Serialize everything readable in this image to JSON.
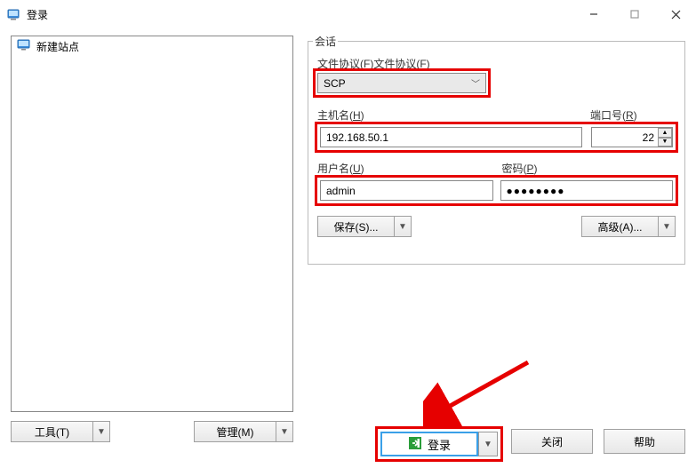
{
  "window": {
    "title": "登录"
  },
  "sidebar": {
    "new_site": "新建站点"
  },
  "session": {
    "group_label": "会话",
    "protocol_label": "文件协议(F)",
    "protocol_value": "SCP",
    "host_label": "主机名(H)",
    "host_value": "192.168.50.1",
    "port_label": "端口号(R)",
    "port_value": "22",
    "user_label": "用户名(U)",
    "user_value": "admin",
    "pass_label": "密码(P)",
    "pass_value": "●●●●●●●●",
    "save_label": "保存(S)...",
    "advanced_label": "高级(A)..."
  },
  "buttons": {
    "tools": "工具(T)",
    "manage": "管理(M)",
    "login": "登录",
    "close": "关闭",
    "help": "帮助"
  }
}
